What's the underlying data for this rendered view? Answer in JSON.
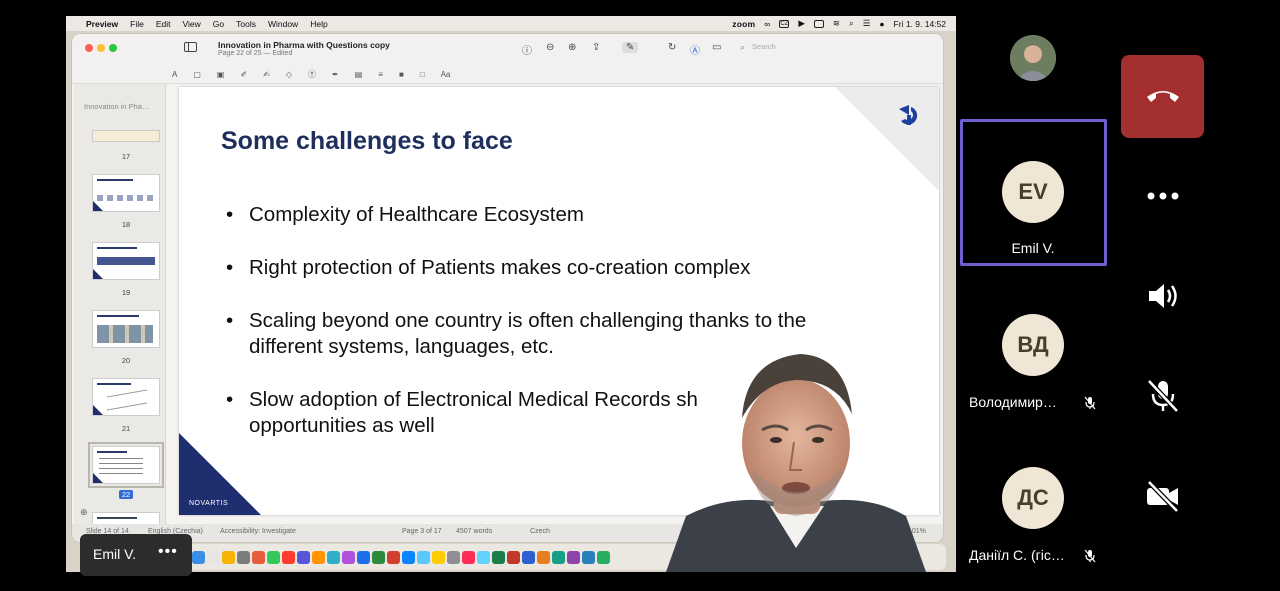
{
  "menubar": {
    "app": "Preview",
    "items": [
      "File",
      "Edit",
      "View",
      "Go",
      "Tools",
      "Window",
      "Help"
    ],
    "zoom_label": "zoom",
    "input_lang": "CZ",
    "datetime": "Fri 1. 9.  14:52"
  },
  "preview": {
    "doc_title": "Innovation in Pharma with Questions copy",
    "doc_subtitle": "Page 22 of 25 — Edited",
    "search_placeholder": "Search",
    "sidebar_title": "Innovation in Pha…",
    "thumbnails": [
      {
        "num": "17"
      },
      {
        "num": "18"
      },
      {
        "num": "19"
      },
      {
        "num": "20"
      },
      {
        "num": "21"
      },
      {
        "num": "22",
        "selected": true
      }
    ],
    "status": {
      "slide": "Slide 14 of 14",
      "language": "English (Czechia)",
      "accessibility": "Accessibility: Investigate",
      "page": "Page 3 of 17",
      "words": "4507 words",
      "lang2": "Czech",
      "zoom": "101%"
    }
  },
  "slide": {
    "title": "Some challenges to face",
    "bullets": [
      "Complexity of Healthcare Ecosystem",
      "Right protection of Patients makes co-creation complex",
      "Scaling beyond one country is often challenging thanks to the different systems, languages, etc.",
      "Slow adoption of Electronical Medical Records sh… opportunities as well"
    ],
    "bullet_lines": [
      [
        "Complexity of Healthcare Ecosystem"
      ],
      [
        "Right protection of Patients makes co-creation complex"
      ],
      [
        "Scaling beyond one country is often challenging thanks to the",
        "different systems, languages, etc."
      ],
      [
        "Slow adoption of Electronical Medical Records sh",
        "opportunities as well"
      ]
    ],
    "brand": "NOVARTIS"
  },
  "self_view": {
    "name": "Emil V.",
    "more": "•••"
  },
  "participants": [
    {
      "initials": "EV",
      "name": "Emil V.",
      "active": true,
      "muted": false
    },
    {
      "initials": "ВД",
      "name": "Володимир…",
      "muted": true
    },
    {
      "initials": "ДС",
      "name": "Даніїл С. (гіс…",
      "muted": true
    }
  ],
  "controls": {
    "leave": "end-call",
    "more": "•••",
    "speaker": "speaker",
    "mic": "mic-off",
    "video": "video-off"
  },
  "colors": {
    "slide_title": "#1e2f5e",
    "leave_button": "#a32f2f",
    "active_border": "#6c61cf",
    "avatar_bg": "#f0e6d6"
  }
}
